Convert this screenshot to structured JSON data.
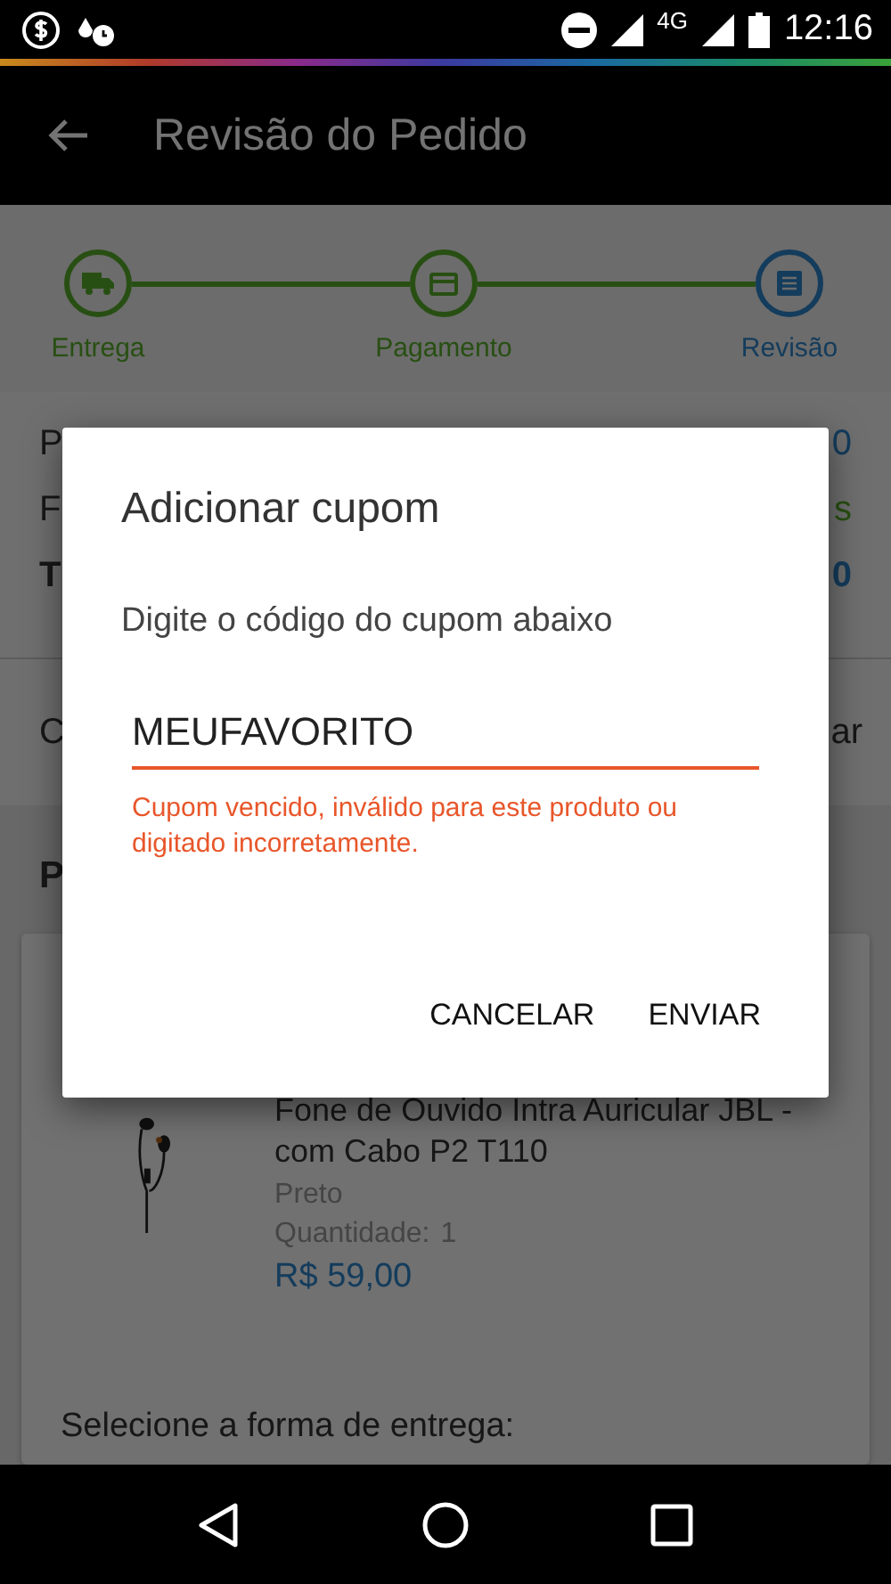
{
  "status_bar": {
    "network": "4G",
    "time": "12:16"
  },
  "app_bar": {
    "title": "Revisão do Pedido"
  },
  "stepper": [
    {
      "label": "Entrega",
      "kind": "delivery",
      "current": false
    },
    {
      "label": "Pagamento",
      "kind": "payment",
      "current": false
    },
    {
      "label": "Revisão",
      "kind": "review",
      "current": true
    }
  ],
  "summary_rows": [
    {
      "label": "P",
      "value": "0",
      "kind": "price"
    },
    {
      "label": "F",
      "value": "s",
      "kind": "free"
    },
    {
      "label": "T",
      "value": "0",
      "kind": "total"
    }
  ],
  "coupon_row": {
    "label": "C",
    "action": "ar"
  },
  "products_section": {
    "heading": "P",
    "product": {
      "name": "Fone de Ouvido Intra Auricular JBL - com Cabo P2 T110",
      "variant": "Preto",
      "quantity_label": "Quantidade:",
      "quantity": "1",
      "price": "R$ 59,00"
    },
    "delivery_heading": "Selecione a forma de entrega:"
  },
  "dialog": {
    "title": "Adicionar cupom",
    "message": "Digite o código do cupom abaixo",
    "input_value": "MEUFAVORITO",
    "error": "Cupom vencido, inválido para este produto ou digitado incorretamente.",
    "buttons": [
      "CANCELAR",
      "ENVIAR"
    ]
  }
}
